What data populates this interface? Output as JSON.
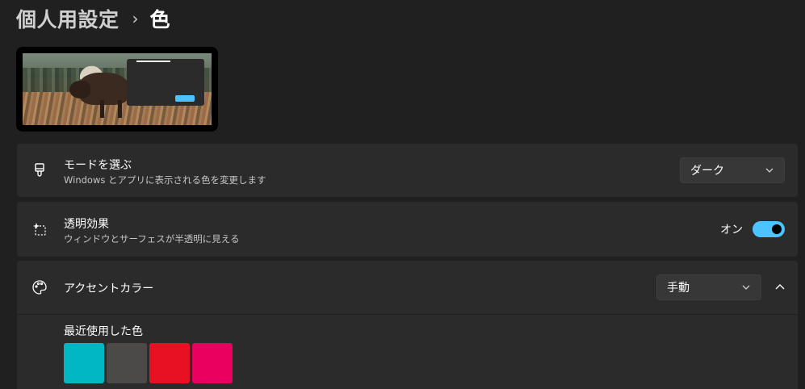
{
  "breadcrumb": {
    "parent": "個人用設定",
    "separator": "›",
    "current": "色"
  },
  "preview": {
    "accent_button_color": "#4cc2ff",
    "window_color": "#2b2b2b"
  },
  "mode": {
    "title": "モードを選ぶ",
    "subtitle": "Windows とアプリに表示される色を変更します",
    "selected": "ダーク",
    "icon": "paintbrush-icon"
  },
  "transparency": {
    "title": "透明効果",
    "subtitle": "ウィンドウとサーフェスが半透明に見える",
    "state_label": "オン",
    "enabled": true,
    "icon": "transparency-icon"
  },
  "accent": {
    "title": "アクセントカラー",
    "selected": "手動",
    "icon": "palette-icon",
    "expanded": true
  },
  "recent_colors": {
    "title": "最近使用した色",
    "colors": [
      "#00b7c3",
      "#4c4a48",
      "#e81123",
      "#ea005e"
    ]
  },
  "theme": {
    "background": "#202020",
    "card": "#2b2b2b",
    "accent": "#4cc2ff"
  }
}
